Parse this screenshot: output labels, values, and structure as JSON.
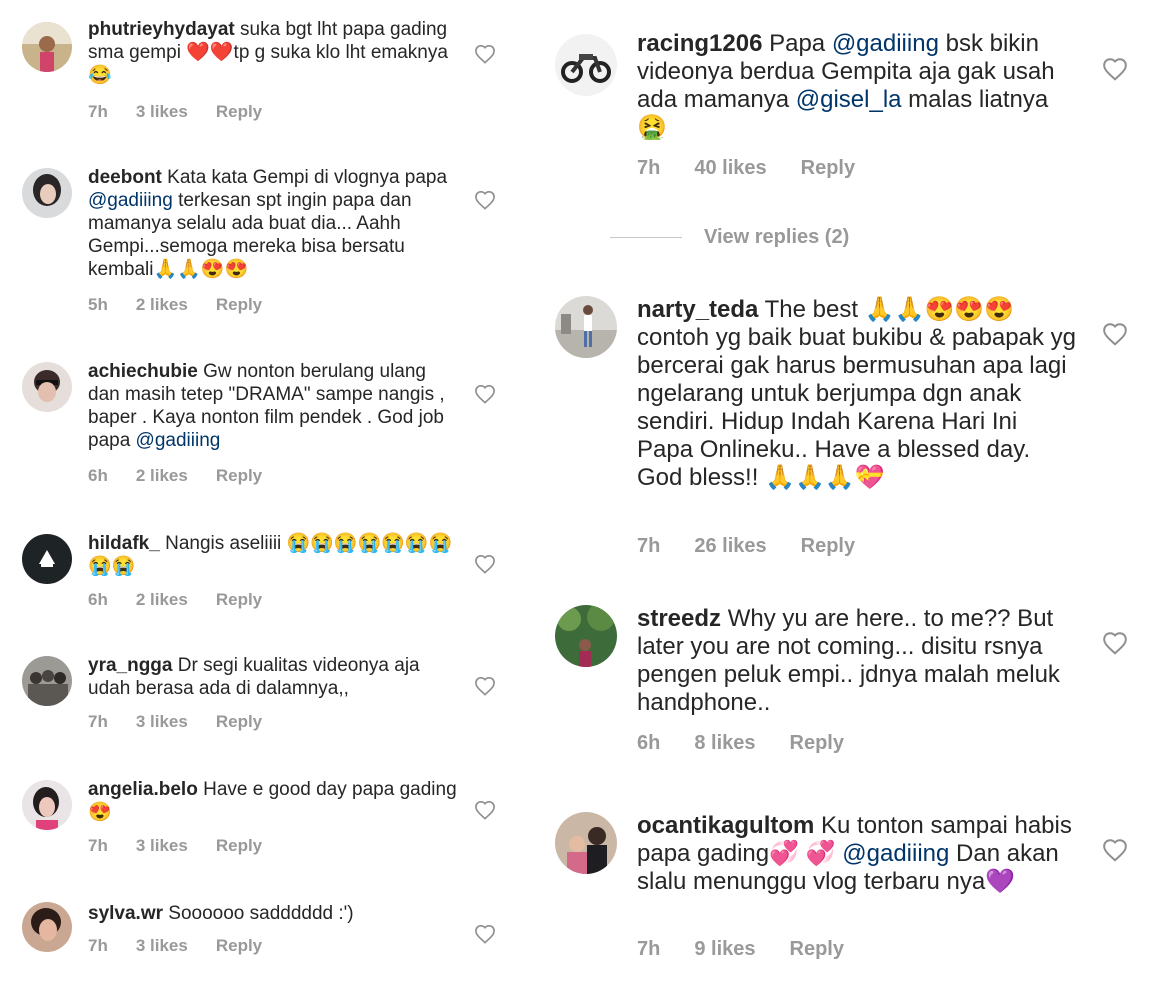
{
  "left_comments": [
    {
      "username": "phutrieyhydayat",
      "parts": [
        {
          "t": "suka bgt lht papa gading sma gempi "
        },
        {
          "e": "❤️"
        },
        {
          "e": "❤️"
        },
        {
          "t": "tp g suka klo lht emaknya "
        },
        {
          "e": "😂"
        }
      ],
      "time": "7h",
      "likes": "3 likes",
      "reply": "Reply"
    },
    {
      "username": "deebont",
      "parts": [
        {
          "t": "Kata kata Gempi di vlognya papa "
        },
        {
          "m": "@gadiiing"
        },
        {
          "t": " terkesan spt ingin papa dan mamanya selalu ada buat dia... Aahh Gempi...semoga mereka bisa bersatu kembali"
        },
        {
          "e": "🙏"
        },
        {
          "e": "🙏"
        },
        {
          "e": "😍"
        },
        {
          "e": "😍"
        }
      ],
      "time": "5h",
      "likes": "2 likes",
      "reply": "Reply"
    },
    {
      "username": "achiechubie",
      "parts": [
        {
          "t": "Gw nonton berulang ulang dan masih tetep \"DRAMA\" sampe nangis , baper . Kaya nonton film pendek . God job papa "
        },
        {
          "m": "@gadiiing"
        }
      ],
      "time": "6h",
      "likes": "2 likes",
      "reply": "Reply"
    },
    {
      "username": "hildafk_",
      "parts": [
        {
          "t": "Nangis aseliiii "
        },
        {
          "e": "😭"
        },
        {
          "e": "😭"
        },
        {
          "e": "😭"
        },
        {
          "e": "😭"
        },
        {
          "e": "😭"
        },
        {
          "e": "😭"
        },
        {
          "e": "😭"
        },
        {
          "e": "😭"
        },
        {
          "e": "😭"
        }
      ],
      "time": "6h",
      "likes": "2 likes",
      "reply": "Reply"
    },
    {
      "username": "yra_ngga",
      "parts": [
        {
          "t": "Dr segi kualitas videonya aja udah berasa ada di dalamnya,,"
        }
      ],
      "time": "7h",
      "likes": "3 likes",
      "reply": "Reply"
    },
    {
      "username": "angelia.belo",
      "parts": [
        {
          "t": "Have e good day papa gading "
        },
        {
          "e": "😍"
        }
      ],
      "time": "7h",
      "likes": "3 likes",
      "reply": "Reply"
    },
    {
      "username": "sylva.wr",
      "parts": [
        {
          "t": "Soooooo sadddddd :')"
        }
      ],
      "time": "7h",
      "likes": "3 likes",
      "reply": "Reply"
    }
  ],
  "right_comments": [
    {
      "username": "racing1206",
      "parts": [
        {
          "t": "Papa "
        },
        {
          "m": "@gadiiing"
        },
        {
          "t": " bsk bikin videonya berdua Gempita aja gak usah ada mamanya "
        },
        {
          "m": "@gisel_la"
        },
        {
          "t": " malas liatnya "
        },
        {
          "e": "🤮"
        }
      ],
      "time": "7h",
      "likes": "40 likes",
      "reply": "Reply"
    },
    {
      "username": "narty_teda",
      "parts": [
        {
          "t": "The best "
        },
        {
          "e": "🙏"
        },
        {
          "e": "🙏"
        },
        {
          "e": "😍"
        },
        {
          "e": "😍"
        },
        {
          "e": "😍"
        },
        {
          "t": " contoh yg baik buat bukibu & pabapak yg bercerai gak harus bermusuhan apa lagi ngelarang untuk berjumpa dgn anak sendiri. Hidup Indah Karena Hari Ini Papa Onlineku.. Have a blessed day.  God bless!! "
        },
        {
          "e": "🙏"
        },
        {
          "e": "🙏"
        },
        {
          "e": "🙏"
        },
        {
          "e": "💝"
        }
      ],
      "time": "7h",
      "likes": "26 likes",
      "reply": "Reply"
    },
    {
      "username": "streedz",
      "parts": [
        {
          "t": "Why yu are here.. to me?? But later you are not coming... disitu rsnya pengen peluk empi.. jdnya malah meluk handphone.."
        }
      ],
      "time": "6h",
      "likes": "8 likes",
      "reply": "Reply"
    },
    {
      "username": "ocantikagultom",
      "parts": [
        {
          "t": "Ku tonton sampai habis papa gading"
        },
        {
          "e": "💞"
        },
        {
          "t": " "
        },
        {
          "e": "💞"
        },
        {
          "t": " "
        },
        {
          "m": "@gadiiing"
        },
        {
          "t": " Dan akan slalu menunggu vlog terbaru nya"
        },
        {
          "e": "💜"
        }
      ],
      "time": "7h",
      "likes": "9 likes",
      "reply": "Reply"
    }
  ],
  "view_replies_label": "View replies (2)",
  "colors": {
    "mention": "#003569",
    "meta": "#999999",
    "text": "#262626",
    "heart": "#8e8e8e"
  }
}
